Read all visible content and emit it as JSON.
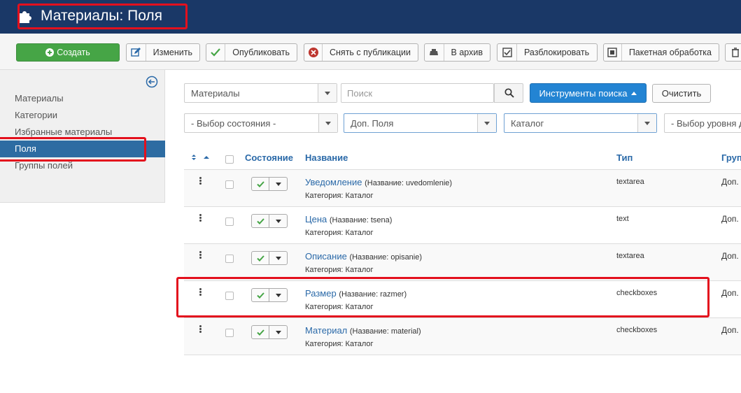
{
  "header": {
    "title": "Материалы: Поля"
  },
  "toolbar": {
    "create": "Создать",
    "edit": "Изменить",
    "publish": "Опубликовать",
    "unpublish": "Снять с публикации",
    "archive": "В архив",
    "checkin": "Разблокировать",
    "batch": "Пакетная обработка"
  },
  "sidebar": {
    "items": [
      {
        "label": "Материалы"
      },
      {
        "label": "Категории"
      },
      {
        "label": "Избранные материалы"
      },
      {
        "label": "Поля",
        "active": true
      },
      {
        "label": "Группы полей"
      }
    ]
  },
  "filters": {
    "context": "Материалы",
    "search_placeholder": "Поиск",
    "search_tools": "Инструменты поиска",
    "clear": "Очистить",
    "state": "- Выбор состояния -",
    "group": "Доп. Поля",
    "category": "Каталог",
    "level": "- Выбор уровня д"
  },
  "table": {
    "headers": {
      "state": "Состояние",
      "title": "Название",
      "type": "Тип",
      "group": "Груп"
    },
    "rows": [
      {
        "title": "Уведомление",
        "alias": "(Название: uvedomlenie)",
        "category": "Категория: Каталог",
        "type": "textarea",
        "group": "Доп."
      },
      {
        "title": "Цена",
        "alias": "(Название: tsena)",
        "category": "Категория: Каталог",
        "type": "text",
        "group": "Доп."
      },
      {
        "title": "Описание",
        "alias": "(Название: opisanie)",
        "category": "Категория: Каталог",
        "type": "textarea",
        "group": "Доп."
      },
      {
        "title": "Размер",
        "alias": "(Название: razmer)",
        "category": "Категория: Каталог",
        "type": "checkboxes",
        "group": "Доп."
      },
      {
        "title": "Материал",
        "alias": "(Название: material)",
        "category": "Категория: Каталог",
        "type": "checkboxes",
        "group": "Доп."
      }
    ]
  },
  "colors": {
    "header_bg": "#1a3867",
    "accent": "#2384d3",
    "active_sidebar": "#2d6ca2",
    "create_green": "#46a546",
    "highlight_red": "#e3101d"
  }
}
